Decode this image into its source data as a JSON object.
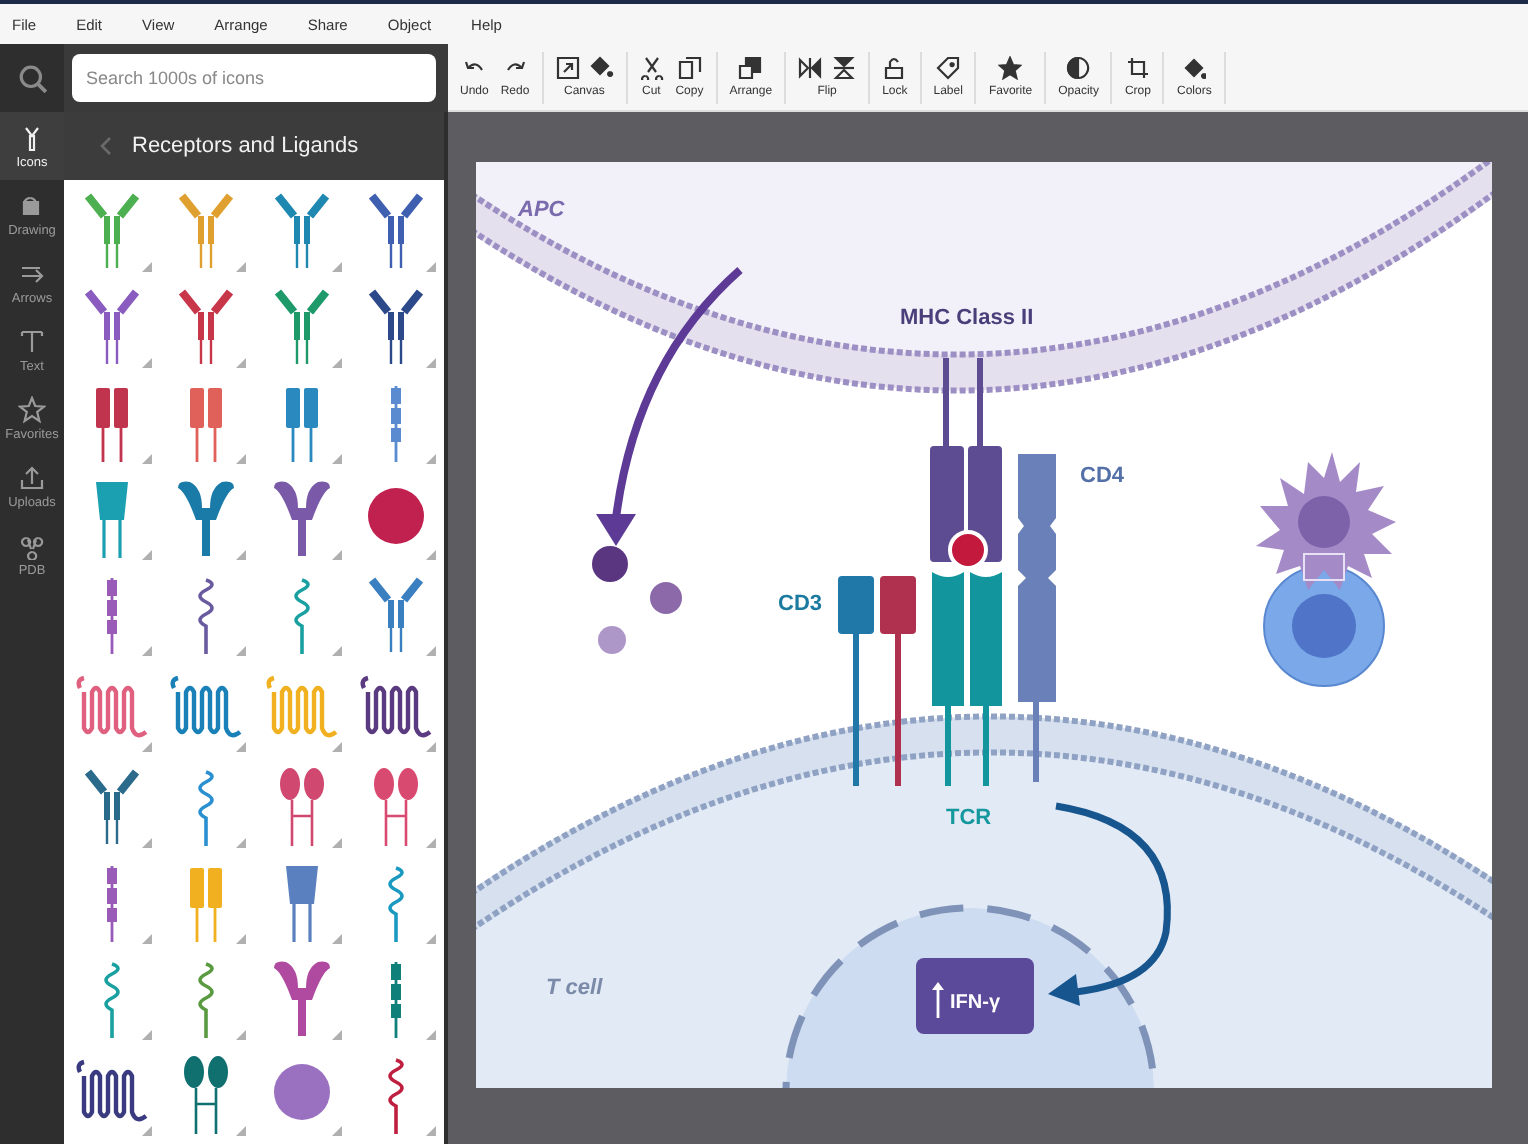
{
  "menu": [
    "File",
    "Edit",
    "View",
    "Arrange",
    "Share",
    "Object",
    "Help"
  ],
  "search": {
    "placeholder": "Search 1000s of icons"
  },
  "toolbar_groups": [
    [
      {
        "label": "Undo"
      },
      {
        "label": "Redo"
      }
    ],
    [
      {
        "label": "Canvas"
      }
    ],
    [
      {
        "label": "Cut"
      },
      {
        "label": "Copy"
      }
    ],
    [
      {
        "label": "Arrange"
      }
    ],
    [
      {
        "label": "Flip"
      }
    ],
    [
      {
        "label": "Lock"
      }
    ],
    [
      {
        "label": "Label"
      }
    ],
    [
      {
        "label": "Favorite"
      }
    ],
    [
      {
        "label": "Opacity"
      }
    ],
    [
      {
        "label": "Crop"
      }
    ],
    [
      {
        "label": "Colors"
      }
    ]
  ],
  "rail": [
    {
      "label": "Icons",
      "selected": true
    },
    {
      "label": "Drawing",
      "selected": false
    },
    {
      "label": "Arrows",
      "selected": false
    },
    {
      "label": "Text",
      "selected": false
    },
    {
      "label": "Favorites",
      "selected": false
    },
    {
      "label": "Uploads",
      "selected": false
    },
    {
      "label": "PDB",
      "selected": false
    }
  ],
  "panel": {
    "title": "Receptors and Ligands"
  },
  "icons": [
    {
      "kind": "antibody",
      "color": "#4caf50"
    },
    {
      "kind": "antibody",
      "color": "#e0a030"
    },
    {
      "kind": "antibody",
      "color": "#1e88b0"
    },
    {
      "kind": "antibody",
      "color": "#3f5fb0"
    },
    {
      "kind": "antibody",
      "color": "#8a5cc0"
    },
    {
      "kind": "antibody",
      "color": "#c8364a"
    },
    {
      "kind": "antibody",
      "color": "#1e9a6a"
    },
    {
      "kind": "antibody",
      "color": "#2c4a8a"
    },
    {
      "kind": "paired",
      "color": "#c0344e"
    },
    {
      "kind": "paired",
      "color": "#e0605a"
    },
    {
      "kind": "paired",
      "color": "#2a8ac0"
    },
    {
      "kind": "chain",
      "color": "#5a8ad0"
    },
    {
      "kind": "column",
      "color": "#1aa0b0"
    },
    {
      "kind": "tulip",
      "color": "#1a7aa8"
    },
    {
      "kind": "tulip",
      "color": "#7a5aa8"
    },
    {
      "kind": "sphere",
      "color": "#c0214e"
    },
    {
      "kind": "chain",
      "color": "#9a5ab8"
    },
    {
      "kind": "coil",
      "color": "#6a5aa0"
    },
    {
      "kind": "coil",
      "color": "#1aa0a0"
    },
    {
      "kind": "antibody",
      "color": "#3a80c0"
    },
    {
      "kind": "gpcr",
      "color": "#e06080"
    },
    {
      "kind": "gpcr",
      "color": "#1a80b8"
    },
    {
      "kind": "gpcr",
      "color": "#f0b020"
    },
    {
      "kind": "gpcr",
      "color": "#5a3a80"
    },
    {
      "kind": "antibody",
      "color": "#2a6a8a"
    },
    {
      "kind": "coil",
      "color": "#2a90d0"
    },
    {
      "kind": "paddle",
      "color": "#d04870"
    },
    {
      "kind": "paddle",
      "color": "#d84a70"
    },
    {
      "kind": "chain",
      "color": "#9a5ab8"
    },
    {
      "kind": "paired",
      "color": "#f0b020"
    },
    {
      "kind": "column",
      "color": "#5a80c0"
    },
    {
      "kind": "coil",
      "color": "#1a9ac0"
    },
    {
      "kind": "coil",
      "color": "#1aa0a0"
    },
    {
      "kind": "coil",
      "color": "#5a9a40"
    },
    {
      "kind": "tulip",
      "color": "#b04aa0"
    },
    {
      "kind": "chain",
      "color": "#10807a"
    },
    {
      "kind": "gpcr",
      "color": "#3a3a80"
    },
    {
      "kind": "paddle",
      "color": "#107070"
    },
    {
      "kind": "sphere",
      "color": "#9a70c0"
    },
    {
      "kind": "coil",
      "color": "#c02040"
    }
  ],
  "diagram": {
    "apc_label": "APC",
    "mhc_label": "MHC Class II",
    "cd4_label": "CD4",
    "cd3_label": "CD3",
    "tcr_label": "TCR",
    "tcell_label": "T cell",
    "cytokine_label": "IFN-γ"
  }
}
